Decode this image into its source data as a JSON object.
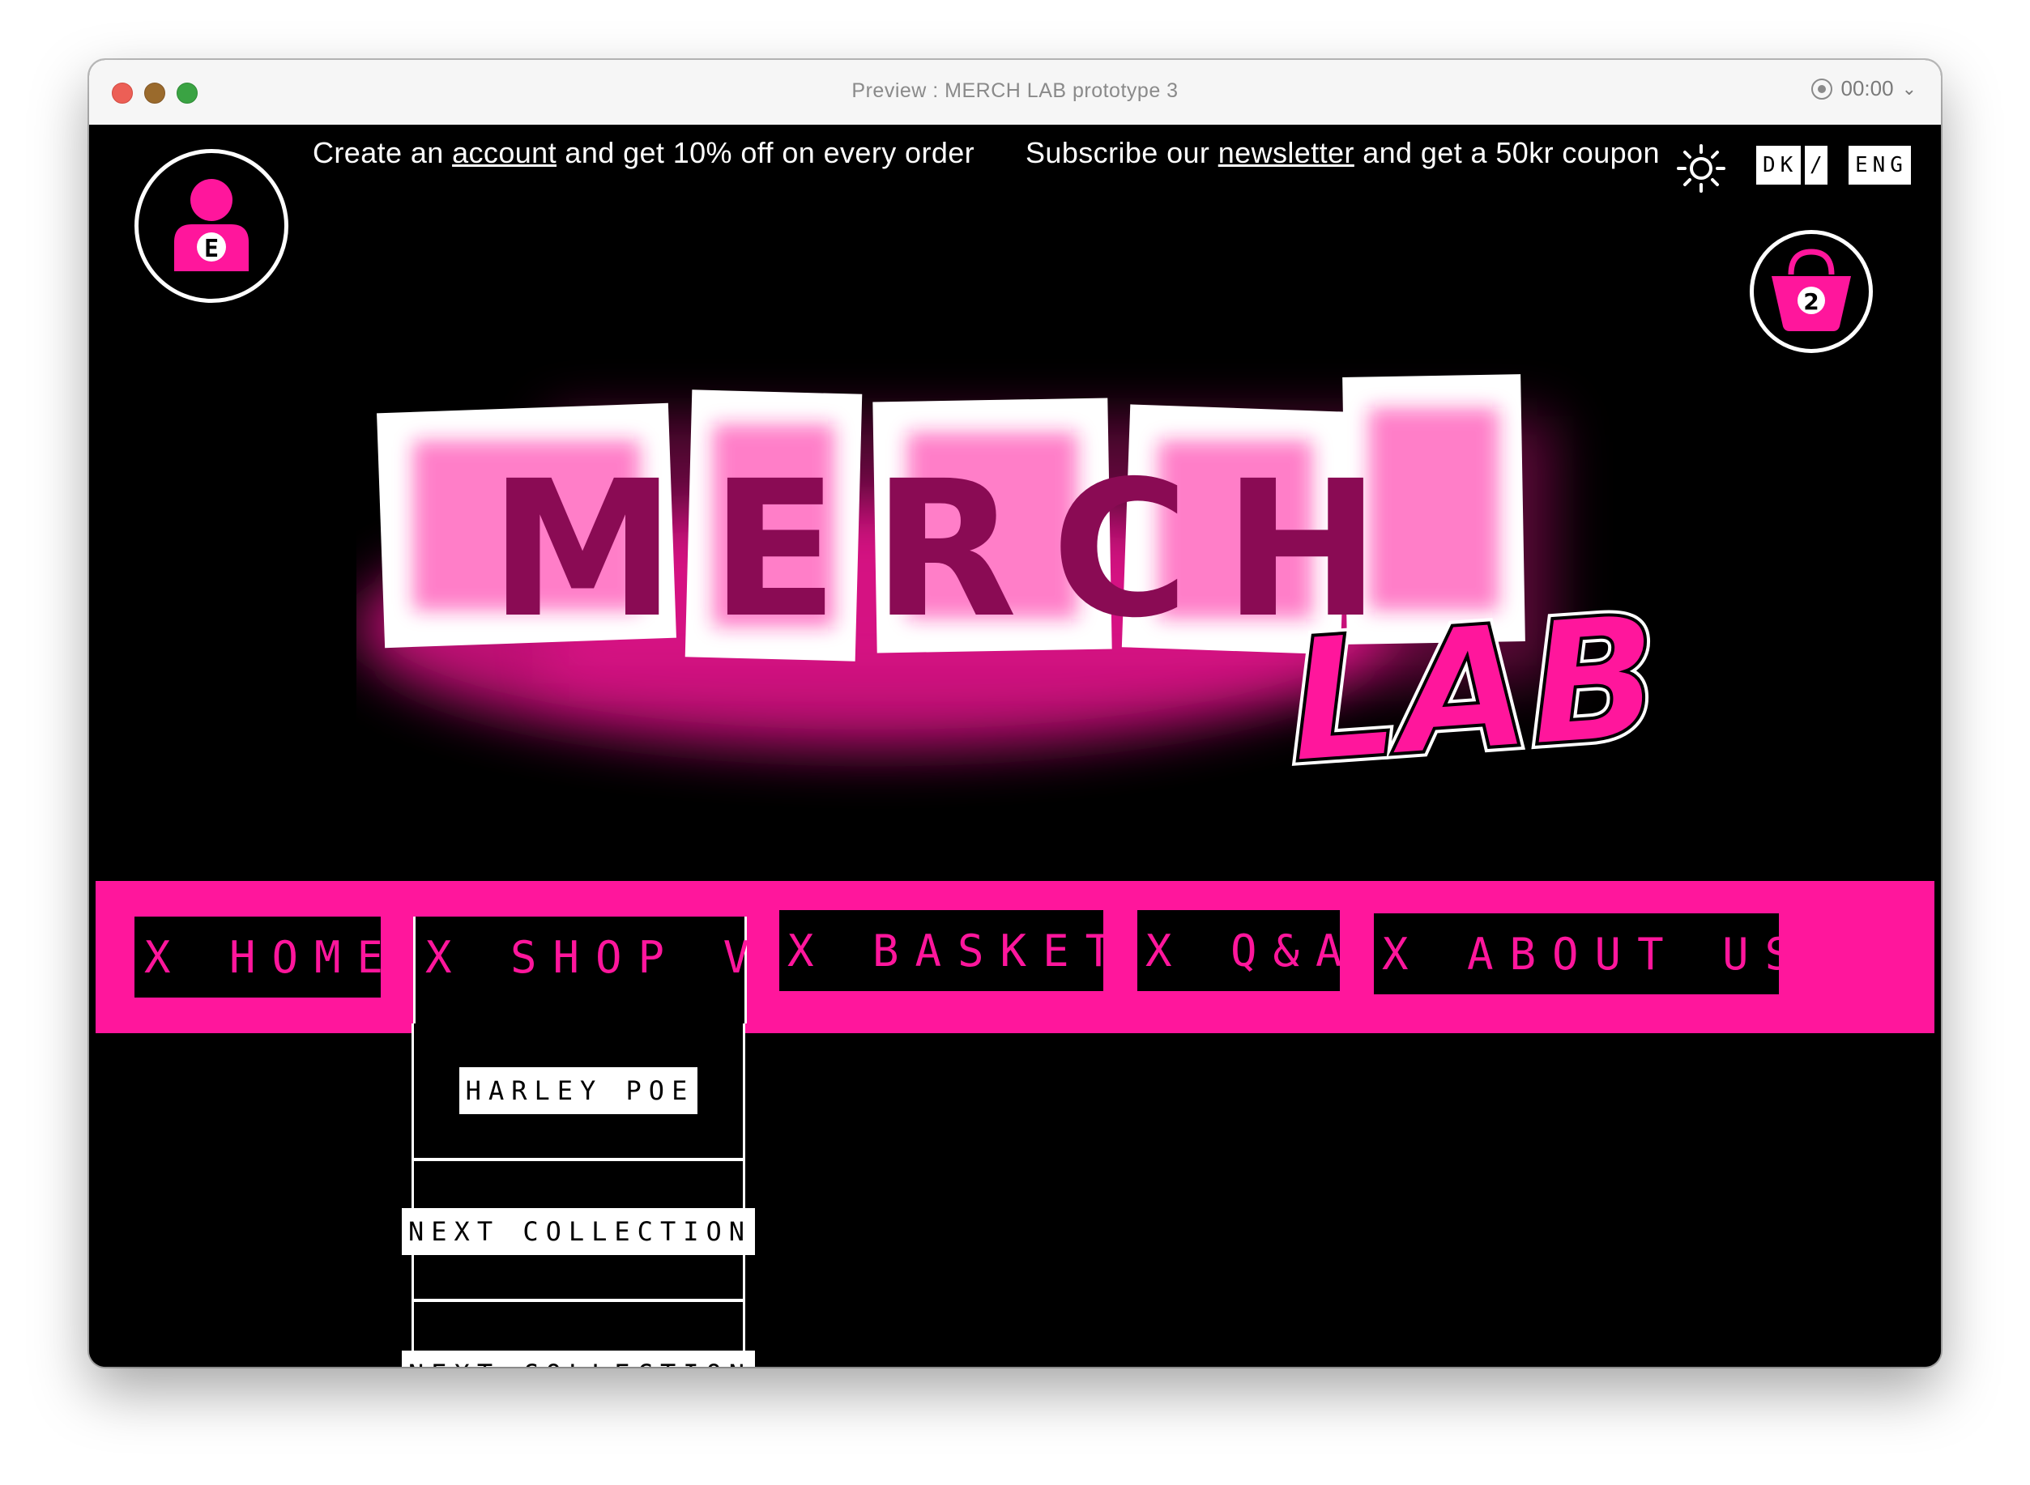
{
  "window": {
    "title": "Preview : MERCH LAB prototype 3",
    "recording_time": "00:00",
    "recording_chevron": "⌄"
  },
  "promo": {
    "account_prefix": "Create an ",
    "account_link": "account",
    "account_suffix": " and get 10% off on every order",
    "newsletter_prefix": "Subscribe our ",
    "newsletter_link": "newsletter",
    "newsletter_suffix": " and get a 50kr coupon"
  },
  "language": {
    "dk": "DK",
    "separator": "/",
    "eng": "ENG"
  },
  "account": {
    "initial": "E",
    "icon": "user-icon"
  },
  "basket": {
    "count": "2",
    "icon": "shopping-bag-icon"
  },
  "logo": {
    "merch_text": "MERCH",
    "lab_text": "LAB"
  },
  "nav": {
    "home": "X HOME",
    "shop": "X SHOP V",
    "basket": "X BASKET",
    "qa": "X Q&A",
    "about": "X ABOUT US"
  },
  "shop_menu": {
    "items": [
      "HARLEY POE",
      "NEXT COLLECTION",
      "NEXT COLLECTION"
    ]
  },
  "colors": {
    "accent": "#ff169c",
    "background": "#000000",
    "text": "#ffffff"
  }
}
